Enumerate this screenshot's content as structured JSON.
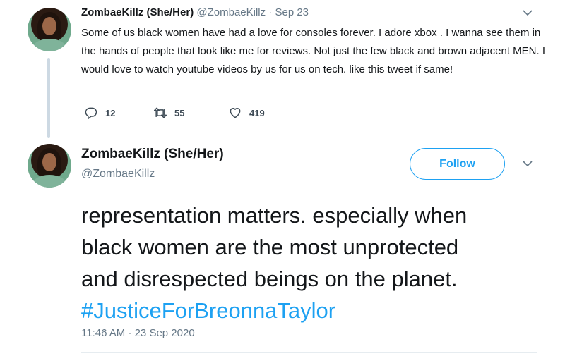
{
  "tweet1": {
    "author_name": "ZombaeKillz (She/Her)",
    "handle": "@ZombaeKillz",
    "separator": " · ",
    "date": "Sep 23",
    "text": "Some of us black women have had a love for consoles forever. I adore xbox . I wanna see them in the hands of people that look like me for reviews.  Not just the few black and brown adjacent MEN.  I would love to watch youtube videos by us for us on tech. like this tweet if same!",
    "reply_count": "12",
    "retweet_count": "55",
    "like_count": "419"
  },
  "tweet2": {
    "author_name": "ZombaeKillz (She/Her)",
    "handle": "@ZombaeKillz",
    "follow_label": "Follow",
    "lines": [
      "representation matters. especially when",
      "black women are the most unprotected",
      "and disrespected beings on the planet."
    ],
    "hashtag": "#JusticeForBreonnaTaylor",
    "timestamp": "11:46 AM - 23 Sep 2020"
  },
  "colors": {
    "accent": "#1da1f2",
    "muted": "#657786",
    "text": "#14171a",
    "thread_line": "#cdd9e3"
  },
  "icons": [
    "reply-icon",
    "retweet-icon",
    "like-icon",
    "chevron-down-icon"
  ]
}
